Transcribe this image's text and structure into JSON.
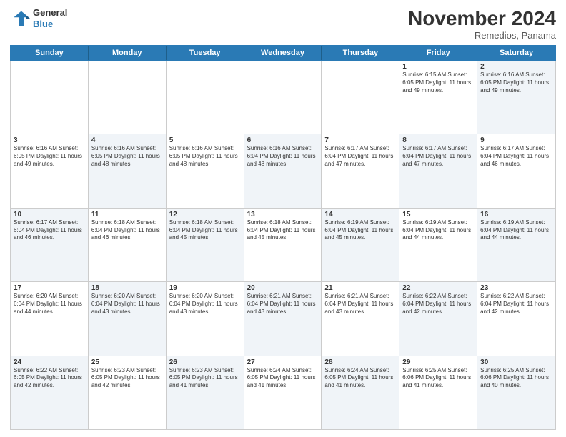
{
  "header": {
    "logo_line1": "General",
    "logo_line2": "Blue",
    "month_title": "November 2024",
    "location": "Remedios, Panama"
  },
  "days_of_week": [
    "Sunday",
    "Monday",
    "Tuesday",
    "Wednesday",
    "Thursday",
    "Friday",
    "Saturday"
  ],
  "weeks": [
    [
      {
        "day": "",
        "info": "",
        "alt": false
      },
      {
        "day": "",
        "info": "",
        "alt": false
      },
      {
        "day": "",
        "info": "",
        "alt": false
      },
      {
        "day": "",
        "info": "",
        "alt": false
      },
      {
        "day": "",
        "info": "",
        "alt": false
      },
      {
        "day": "1",
        "info": "Sunrise: 6:15 AM\nSunset: 6:05 PM\nDaylight: 11 hours and 49 minutes.",
        "alt": false
      },
      {
        "day": "2",
        "info": "Sunrise: 6:16 AM\nSunset: 6:05 PM\nDaylight: 11 hours and 49 minutes.",
        "alt": true
      }
    ],
    [
      {
        "day": "3",
        "info": "Sunrise: 6:16 AM\nSunset: 6:05 PM\nDaylight: 11 hours and 49 minutes.",
        "alt": false
      },
      {
        "day": "4",
        "info": "Sunrise: 6:16 AM\nSunset: 6:05 PM\nDaylight: 11 hours and 48 minutes.",
        "alt": true
      },
      {
        "day": "5",
        "info": "Sunrise: 6:16 AM\nSunset: 6:05 PM\nDaylight: 11 hours and 48 minutes.",
        "alt": false
      },
      {
        "day": "6",
        "info": "Sunrise: 6:16 AM\nSunset: 6:04 PM\nDaylight: 11 hours and 48 minutes.",
        "alt": true
      },
      {
        "day": "7",
        "info": "Sunrise: 6:17 AM\nSunset: 6:04 PM\nDaylight: 11 hours and 47 minutes.",
        "alt": false
      },
      {
        "day": "8",
        "info": "Sunrise: 6:17 AM\nSunset: 6:04 PM\nDaylight: 11 hours and 47 minutes.",
        "alt": true
      },
      {
        "day": "9",
        "info": "Sunrise: 6:17 AM\nSunset: 6:04 PM\nDaylight: 11 hours and 46 minutes.",
        "alt": false
      }
    ],
    [
      {
        "day": "10",
        "info": "Sunrise: 6:17 AM\nSunset: 6:04 PM\nDaylight: 11 hours and 46 minutes.",
        "alt": true
      },
      {
        "day": "11",
        "info": "Sunrise: 6:18 AM\nSunset: 6:04 PM\nDaylight: 11 hours and 46 minutes.",
        "alt": false
      },
      {
        "day": "12",
        "info": "Sunrise: 6:18 AM\nSunset: 6:04 PM\nDaylight: 11 hours and 45 minutes.",
        "alt": true
      },
      {
        "day": "13",
        "info": "Sunrise: 6:18 AM\nSunset: 6:04 PM\nDaylight: 11 hours and 45 minutes.",
        "alt": false
      },
      {
        "day": "14",
        "info": "Sunrise: 6:19 AM\nSunset: 6:04 PM\nDaylight: 11 hours and 45 minutes.",
        "alt": true
      },
      {
        "day": "15",
        "info": "Sunrise: 6:19 AM\nSunset: 6:04 PM\nDaylight: 11 hours and 44 minutes.",
        "alt": false
      },
      {
        "day": "16",
        "info": "Sunrise: 6:19 AM\nSunset: 6:04 PM\nDaylight: 11 hours and 44 minutes.",
        "alt": true
      }
    ],
    [
      {
        "day": "17",
        "info": "Sunrise: 6:20 AM\nSunset: 6:04 PM\nDaylight: 11 hours and 44 minutes.",
        "alt": false
      },
      {
        "day": "18",
        "info": "Sunrise: 6:20 AM\nSunset: 6:04 PM\nDaylight: 11 hours and 43 minutes.",
        "alt": true
      },
      {
        "day": "19",
        "info": "Sunrise: 6:20 AM\nSunset: 6:04 PM\nDaylight: 11 hours and 43 minutes.",
        "alt": false
      },
      {
        "day": "20",
        "info": "Sunrise: 6:21 AM\nSunset: 6:04 PM\nDaylight: 11 hours and 43 minutes.",
        "alt": true
      },
      {
        "day": "21",
        "info": "Sunrise: 6:21 AM\nSunset: 6:04 PM\nDaylight: 11 hours and 43 minutes.",
        "alt": false
      },
      {
        "day": "22",
        "info": "Sunrise: 6:22 AM\nSunset: 6:04 PM\nDaylight: 11 hours and 42 minutes.",
        "alt": true
      },
      {
        "day": "23",
        "info": "Sunrise: 6:22 AM\nSunset: 6:04 PM\nDaylight: 11 hours and 42 minutes.",
        "alt": false
      }
    ],
    [
      {
        "day": "24",
        "info": "Sunrise: 6:22 AM\nSunset: 6:05 PM\nDaylight: 11 hours and 42 minutes.",
        "alt": true
      },
      {
        "day": "25",
        "info": "Sunrise: 6:23 AM\nSunset: 6:05 PM\nDaylight: 11 hours and 42 minutes.",
        "alt": false
      },
      {
        "day": "26",
        "info": "Sunrise: 6:23 AM\nSunset: 6:05 PM\nDaylight: 11 hours and 41 minutes.",
        "alt": true
      },
      {
        "day": "27",
        "info": "Sunrise: 6:24 AM\nSunset: 6:05 PM\nDaylight: 11 hours and 41 minutes.",
        "alt": false
      },
      {
        "day": "28",
        "info": "Sunrise: 6:24 AM\nSunset: 6:05 PM\nDaylight: 11 hours and 41 minutes.",
        "alt": true
      },
      {
        "day": "29",
        "info": "Sunrise: 6:25 AM\nSunset: 6:06 PM\nDaylight: 11 hours and 41 minutes.",
        "alt": false
      },
      {
        "day": "30",
        "info": "Sunrise: 6:25 AM\nSunset: 6:06 PM\nDaylight: 11 hours and 40 minutes.",
        "alt": true
      }
    ]
  ]
}
